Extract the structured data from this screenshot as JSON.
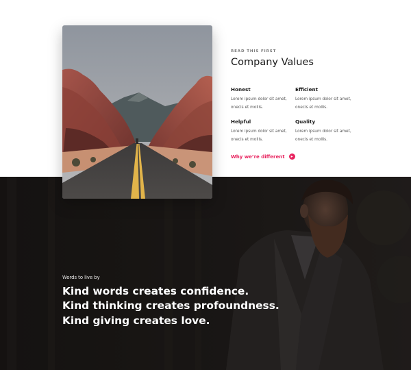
{
  "values_section": {
    "eyebrow": "READ THIS FIRST",
    "title": "Company Values",
    "items": [
      {
        "title": "Honest",
        "description": "Lorem ipsum dolor sit amet, onecis et mollis."
      },
      {
        "title": "Efficient",
        "description": "Lorem ipsum dolor sit amet, onecis et mollis."
      },
      {
        "title": "Helpful",
        "description": "Lorem ipsum dolor sit amet, onecis et mollis."
      },
      {
        "title": "Quality",
        "description": "Lorem ipsum dolor sit amet, onecis et mollis."
      }
    ],
    "cta_label": "Why we’re different",
    "cta_icon": "arrow-right-circle"
  },
  "photo": {
    "subject": "desert road through red rock canyon"
  },
  "quote_section": {
    "eyebrow": "Words to live by",
    "lines": [
      "Kind words creates confidence.",
      "Kind thinking creates profoundness.",
      "Kind giving creates love."
    ],
    "background_subject": "bearded man in dark jacket"
  },
  "colors": {
    "accent": "#e8245f",
    "dark_background": "#201d1c",
    "text_dark": "#1a1a1a"
  }
}
